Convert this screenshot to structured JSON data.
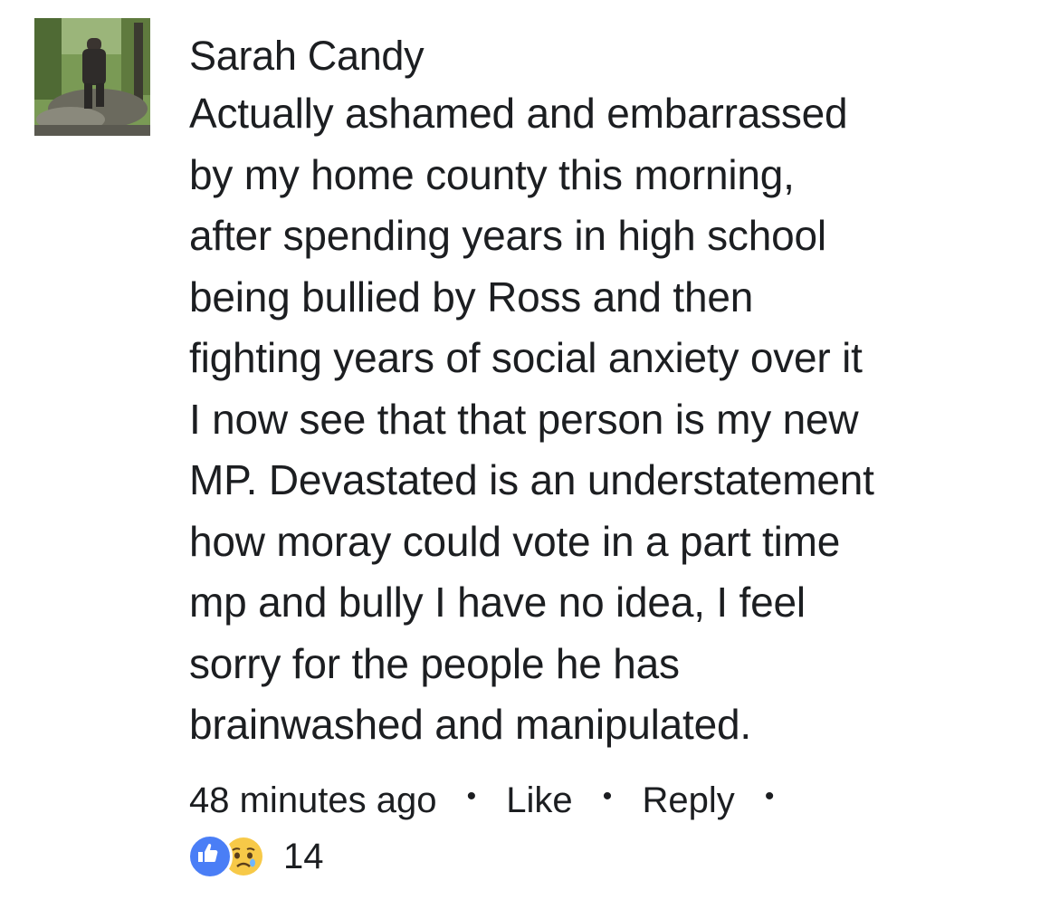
{
  "comment": {
    "author": "Sarah Candy",
    "text_lines": [
      "Actually ashamed and embarrassed",
      "by my home county this morning,",
      "after spending years in high school",
      "being bullied by Ross and then",
      "fighting years of social anxiety over it",
      "I now see that that person is my new",
      "MP. Devastated is an understatement",
      "how moray could vote in a part time",
      "mp and bully I have no idea, I feel",
      "sorry for the people he has",
      "brainwashed and manipulated."
    ],
    "timestamp": "48 minutes ago",
    "separator": "•",
    "like_label": "Like",
    "reply_label": "Reply",
    "reaction_count": "14",
    "reactions": [
      "like-icon",
      "sad-icon"
    ],
    "colors": {
      "like": "#4a7ef6",
      "sad": "#f7c948",
      "text": "#1c1e21"
    }
  }
}
